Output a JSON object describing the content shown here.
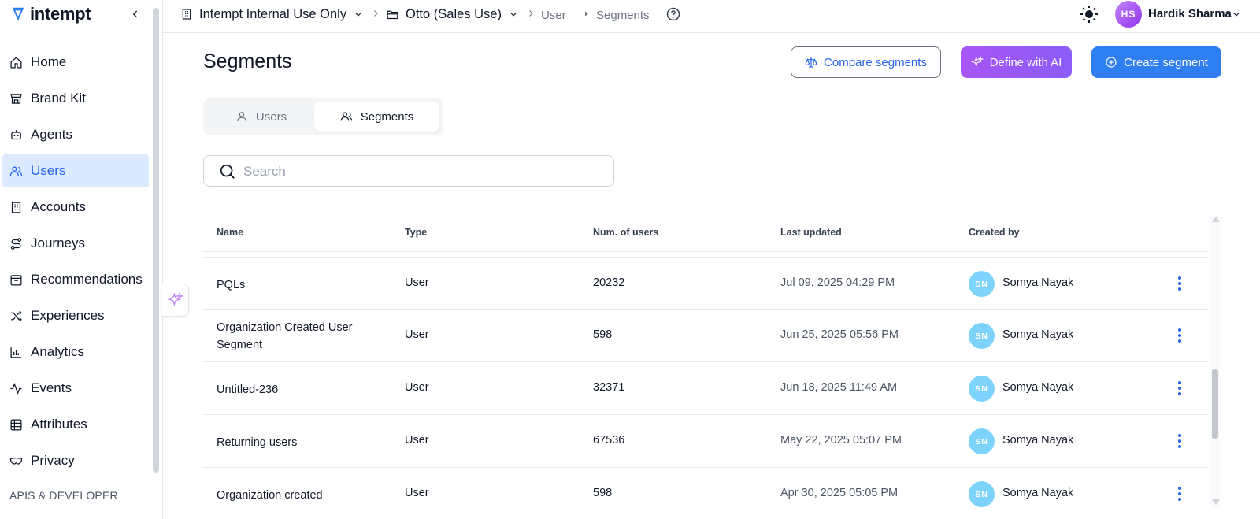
{
  "app": {
    "logo_text": "intempt"
  },
  "sidebar": {
    "items": [
      {
        "label": "Home",
        "icon": "home-icon"
      },
      {
        "label": "Brand Kit",
        "icon": "store-icon"
      },
      {
        "label": "Agents",
        "icon": "robot-icon"
      },
      {
        "label": "Users",
        "icon": "users-icon",
        "active": true
      },
      {
        "label": "Accounts",
        "icon": "building-icon"
      },
      {
        "label": "Journeys",
        "icon": "route-icon"
      },
      {
        "label": "Recommendations",
        "icon": "package-icon"
      },
      {
        "label": "Experiences",
        "icon": "shuffle-icon"
      },
      {
        "label": "Analytics",
        "icon": "bar-chart-icon"
      },
      {
        "label": "Events",
        "icon": "activity-icon"
      },
      {
        "label": "Attributes",
        "icon": "table-icon"
      },
      {
        "label": "Privacy",
        "icon": "mask-icon"
      }
    ],
    "section_label": "APIS & DEVELOPER"
  },
  "topbar": {
    "org": "Intempt Internal Use Only",
    "project": "Otto (Sales Use)",
    "crumb_1": "User",
    "crumb_2": "Segments",
    "user_initials": "HS",
    "user_name": "Hardik Sharma"
  },
  "page": {
    "title": "Segments",
    "compare_label": "Compare segments",
    "ai_label": "Define with AI",
    "create_label": "Create segment",
    "toggle_users": "Users",
    "toggle_segments": "Segments",
    "search_placeholder": "Search"
  },
  "table": {
    "headers": [
      "Name",
      "Type",
      "Num. of users",
      "Last updated",
      "Created by"
    ],
    "rows": [
      {
        "name": "PQLs",
        "type": "User",
        "users": "20232",
        "updated": "Jul 09, 2025 04:29 PM",
        "initials": "SN",
        "creator": "Somya Nayak"
      },
      {
        "name": "Organization Created User Segment",
        "type": "User",
        "users": "598",
        "updated": "Jun 25, 2025 05:56 PM",
        "initials": "SN",
        "creator": "Somya Nayak"
      },
      {
        "name": "Untitled-236",
        "type": "User",
        "users": "32371",
        "updated": "Jun 18, 2025 11:49 AM",
        "initials": "SN",
        "creator": "Somya Nayak"
      },
      {
        "name": "Returning users",
        "type": "User",
        "users": "67536",
        "updated": "May 22, 2025 05:07 PM",
        "initials": "SN",
        "creator": "Somya Nayak"
      },
      {
        "name": "Organization created",
        "type": "User",
        "users": "598",
        "updated": "Apr 30, 2025 05:05 PM",
        "initials": "SN",
        "creator": "Somya Nayak"
      }
    ]
  },
  "colors": {
    "accent": "#2f7ff2",
    "ai": "#a855f7",
    "active_bg": "#dbeafe"
  }
}
